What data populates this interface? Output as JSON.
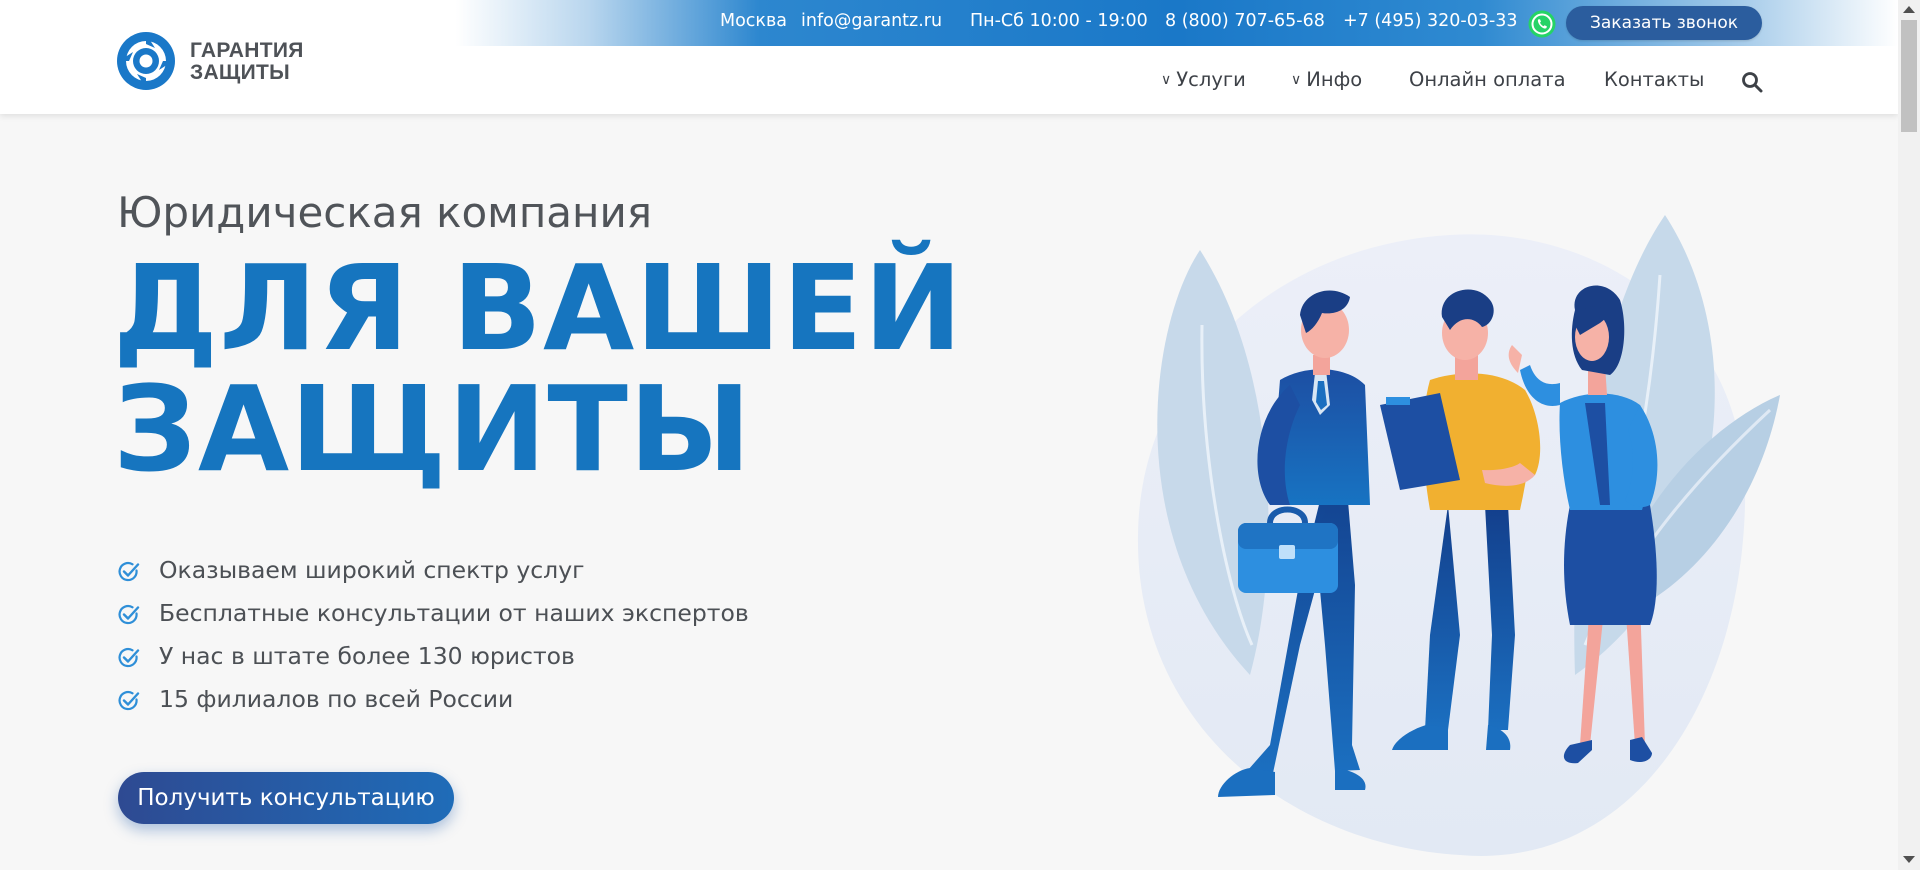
{
  "topbar": {
    "city": "Москва",
    "email": "info@garantz.ru",
    "hours": "Пн-Сб 10:00 - 19:00",
    "phone1": "8 (800) 707-65-68",
    "phone2": "+7 (495) 320-03-33",
    "callback_label": "Заказать звонок",
    "messenger_icon": "whatsapp-icon"
  },
  "logo": {
    "line1": "ГАРАНТИЯ",
    "line2": "ЗАЩИТЫ"
  },
  "nav": {
    "services": "Услуги",
    "info": "Инфо",
    "online_payment": "Онлайн оплата",
    "contacts": "Контакты",
    "search_icon": "search-icon"
  },
  "hero": {
    "subtitle": "Юридическая компания",
    "headline_line1": "ДЛЯ ВАШЕЙ",
    "headline_line2": "ЗАЩИТЫ",
    "features": [
      "Оказываем широкий спектр услуг",
      "Бесплатные консультации от наших экспертов",
      "У нас в штате более 130 юристов",
      "15 филиалов по всей России"
    ],
    "cta_label": "Получить консультацию"
  },
  "colors": {
    "brand_blue": "#1675bf",
    "navy": "#2b5d9e",
    "text": "#4c5055",
    "whatsapp_green": "#25d366"
  }
}
